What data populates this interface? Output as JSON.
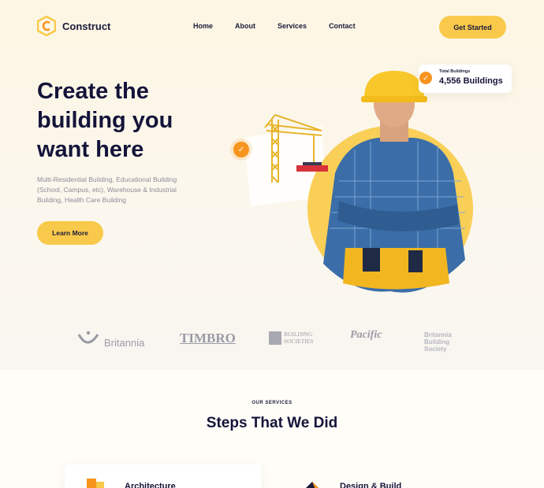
{
  "brand": {
    "name": "Construct",
    "accent": "#f8c94a",
    "orange": "#f6941e",
    "navy": "#14143a"
  },
  "nav": {
    "links": [
      "Home",
      "About",
      "Services",
      "Contact"
    ],
    "cta": "Get Started"
  },
  "hero": {
    "title": "Create the building you want here",
    "subtitle": "Multi-Residential Building, Educational Building (School, Campus, etc), Warehouse & Industrial Building, Health Care Building",
    "button": "Learn More"
  },
  "stat": {
    "label": "Total Buildings",
    "value": "4,556 Buildings",
    "icon": "check-icon"
  },
  "partners": [
    "Britannia",
    "TIMBRO",
    "BUILDING SOCIETIES",
    "Pacific",
    "Britannia Building Society"
  ],
  "services": {
    "eyebrow": "OUR SERVICES",
    "title": "Steps That We Did",
    "cards": [
      "Architecture",
      "Design & Build"
    ]
  }
}
